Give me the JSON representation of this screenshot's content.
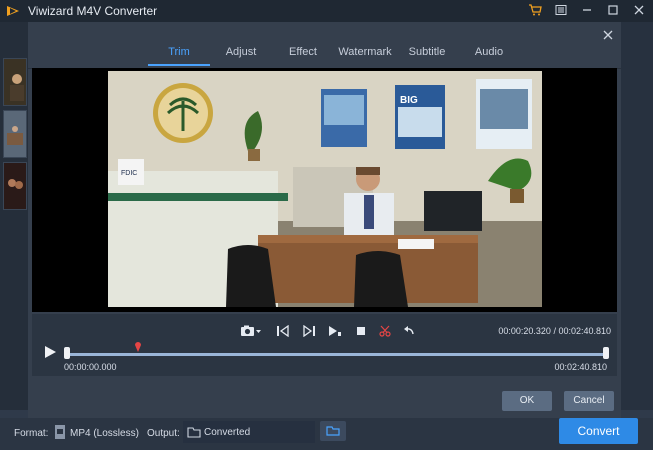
{
  "window": {
    "title": "Viwizard M4V Converter"
  },
  "dialog": {
    "tabs": [
      "Trim",
      "Adjust",
      "Effect",
      "Watermark",
      "Subtitle",
      "Audio"
    ],
    "active_tab": "Trim",
    "controls": {
      "current_time": "00:00:20.320 / 00:02:40.810",
      "start_time": "00:00:00.000",
      "end_time": "00:02:40.810"
    },
    "ok_label": "OK",
    "cancel_label": "Cancel"
  },
  "video": {
    "sign_text": "FDIC",
    "nameplate_text": "",
    "poster_big": "BIG"
  },
  "bottom": {
    "format_label": "Format:",
    "format_value": "MP4 (Lossless)",
    "output_label": "Output:",
    "output_value": "Converted",
    "convert_label": "Convert"
  },
  "colors": {
    "accent": "#2e8ae6",
    "tab_active": "#4aa3ff",
    "marker": "#e64545"
  },
  "icons": {
    "logo": "app-logo-icon",
    "cart": "cart-icon",
    "menu": "menu-icon",
    "minimize": "minimize-icon",
    "maximize": "maximize-icon",
    "close": "close-icon",
    "camera": "camera-icon",
    "set-start": "set-start-icon",
    "set-end": "set-end-icon",
    "preview": "preview-icon",
    "stop": "stop-icon",
    "cut": "scissors-icon",
    "undo": "undo-icon",
    "play": "play-icon",
    "folder": "folder-icon"
  }
}
